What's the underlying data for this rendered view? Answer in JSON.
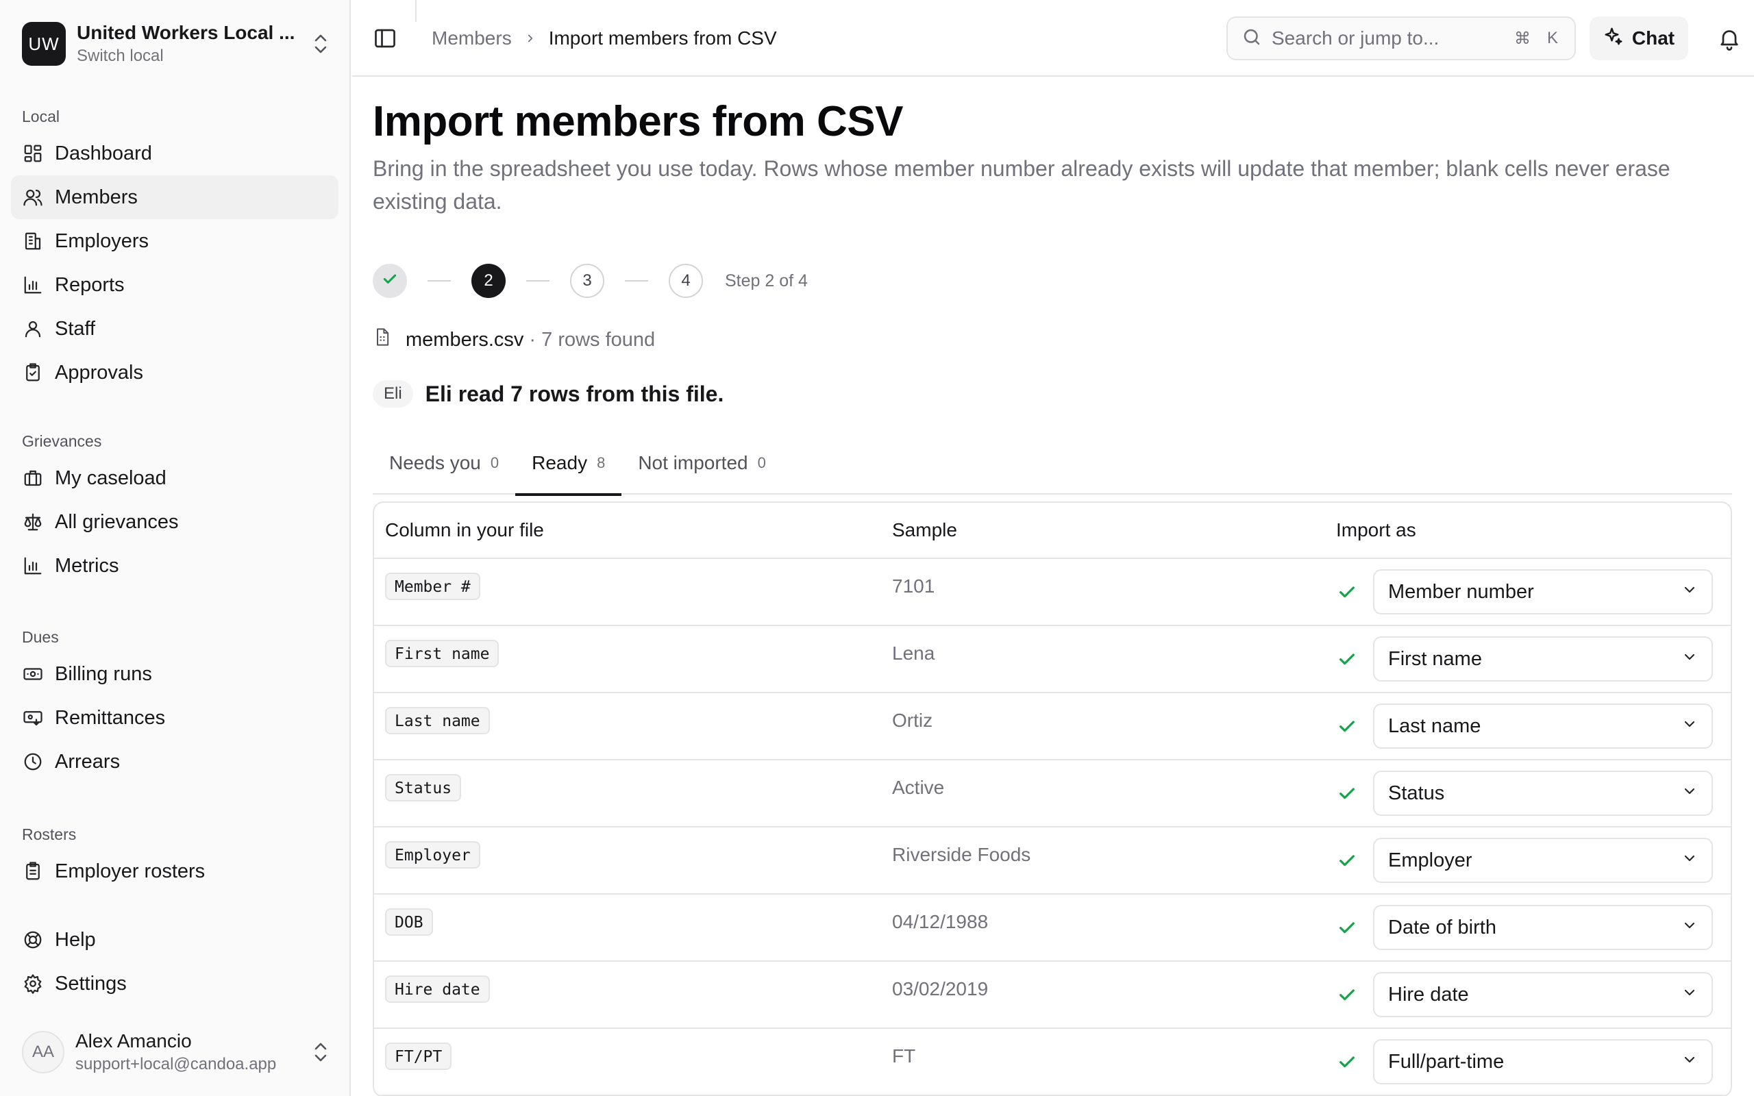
{
  "local": {
    "initials": "UW",
    "name": "United Workers Local ...",
    "switch_label": "Switch local"
  },
  "nav": [
    {
      "heading": "Local",
      "items": [
        {
          "label": "Dashboard",
          "icon": "dashboard-icon",
          "active": false
        },
        {
          "label": "Members",
          "icon": "users-icon",
          "active": true
        },
        {
          "label": "Employers",
          "icon": "building-icon",
          "active": false
        },
        {
          "label": "Reports",
          "icon": "chart-bar-icon",
          "active": false
        },
        {
          "label": "Staff",
          "icon": "user-icon",
          "active": false
        },
        {
          "label": "Approvals",
          "icon": "clipboard-check-icon",
          "active": false
        }
      ]
    },
    {
      "heading": "Grievances",
      "items": [
        {
          "label": "My caseload",
          "icon": "briefcase-icon",
          "active": false
        },
        {
          "label": "All grievances",
          "icon": "scale-icon",
          "active": false
        },
        {
          "label": "Metrics",
          "icon": "chart-bar-icon",
          "active": false
        }
      ]
    },
    {
      "heading": "Dues",
      "items": [
        {
          "label": "Billing runs",
          "icon": "banknote-icon",
          "active": false
        },
        {
          "label": "Remittances",
          "icon": "card-receive-icon",
          "active": false
        },
        {
          "label": "Arrears",
          "icon": "clock-icon",
          "active": false
        }
      ]
    },
    {
      "heading": "Rosters",
      "items": [
        {
          "label": "Employer rosters",
          "icon": "clipboard-list-icon",
          "active": false
        }
      ]
    },
    {
      "heading": "",
      "items": [
        {
          "label": "Help",
          "icon": "lifebuoy-icon",
          "active": false
        },
        {
          "label": "Settings",
          "icon": "gear-icon",
          "active": false
        }
      ]
    }
  ],
  "user": {
    "initials": "AA",
    "name": "Alex Amancio",
    "email": "support+local@candoa.app"
  },
  "topbar": {
    "breadcrumb_parent": "Members",
    "breadcrumb_current": "Import members from CSV",
    "search_placeholder": "Search or jump to...",
    "shortcut_cmd": "⌘",
    "shortcut_key": "K",
    "chat_label": "Chat"
  },
  "page": {
    "title": "Import members from CSV",
    "description": "Bring in the spreadsheet you use today. Rows whose member number already exists will update that member; blank cells never erase existing data."
  },
  "stepper": {
    "steps": [
      "",
      "2",
      "3",
      "4"
    ],
    "current": 2,
    "label": "Step 2 of 4"
  },
  "file": {
    "name": "members.csv",
    "summary": "· 7 rows found"
  },
  "eli": {
    "chip": "Eli",
    "message": "Eli read 7 rows from this file."
  },
  "tabs": [
    {
      "label": "Needs you",
      "count": "0",
      "active": false
    },
    {
      "label": "Ready",
      "count": "8",
      "active": true
    },
    {
      "label": "Not imported",
      "count": "0",
      "active": false
    }
  ],
  "table": {
    "headers": {
      "column": "Column in your file",
      "sample": "Sample",
      "import_as": "Import as"
    },
    "rows": [
      {
        "column": "Member #",
        "sample": "7101",
        "import_as": "Member number"
      },
      {
        "column": "First name",
        "sample": "Lena",
        "import_as": "First name"
      },
      {
        "column": "Last name",
        "sample": "Ortiz",
        "import_as": "Last name"
      },
      {
        "column": "Status",
        "sample": "Active",
        "import_as": "Status"
      },
      {
        "column": "Employer",
        "sample": "Riverside Foods",
        "import_as": "Employer"
      },
      {
        "column": "DOB",
        "sample": "04/12/1988",
        "import_as": "Date of birth"
      },
      {
        "column": "Hire date",
        "sample": "03/02/2019",
        "import_as": "Hire date"
      },
      {
        "column": "FT/PT",
        "sample": "FT",
        "import_as": "Full/part-time"
      }
    ]
  },
  "colors": {
    "accent": "#18181b",
    "check": "#16a34a",
    "muted": "#71717a",
    "border": "#e4e4e7"
  }
}
